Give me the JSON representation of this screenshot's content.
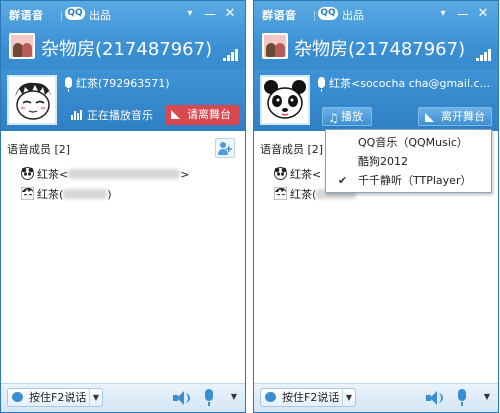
{
  "app": {
    "brand": "群语音",
    "qq_logo": "QQ",
    "brand_suffix": "出品"
  },
  "room": {
    "title": "杂物房(217487967)"
  },
  "left_window": {
    "speaker": "红茶(792963571)",
    "playing_status": "正在播放音乐",
    "stage_button": "请离舞台",
    "members_header": "语音成员 [2]",
    "members": [
      {
        "name": "红茶<",
        "suffix": ">"
      },
      {
        "name": "红茶(",
        "suffix": ")"
      }
    ],
    "ptt_label": "按住F2说话"
  },
  "right_window": {
    "speaker": "红茶<sococha cha@gmail.c...",
    "play_button": "播放",
    "stage_button": "离开舞台",
    "members_header": "语音成员 [2]",
    "members": [
      {
        "name": "红茶<"
      },
      {
        "name": "红茶("
      }
    ],
    "ptt_label": "按住F2说话"
  },
  "player_menu": {
    "items": [
      {
        "label": "QQ音乐（QQMusic）",
        "checked": false
      },
      {
        "label": "酷狗2012",
        "checked": false
      },
      {
        "label": "千千静听（TTPlayer）",
        "checked": true
      }
    ],
    "check_glyph": "✔"
  },
  "colors": {
    "title_blue": "#3a8fd3",
    "stage_red": "#d9484f",
    "accent": "#3c8ed3"
  },
  "icons": [
    "close-icon",
    "minimize-icon",
    "menu-icon",
    "signal-icon",
    "mic-icon",
    "music-note-icon",
    "flag-icon",
    "add-member-icon",
    "speaker-icon",
    "chevron-down-icon",
    "checkmark-icon"
  ]
}
